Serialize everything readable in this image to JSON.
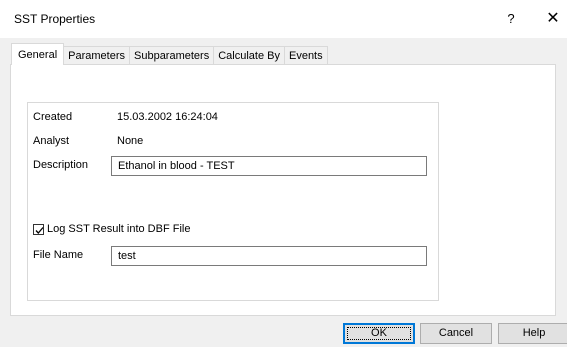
{
  "window": {
    "title": "SST Properties",
    "help_glyph": "?",
    "close_glyph": "✕"
  },
  "tabs": [
    {
      "label": "General",
      "active": true
    },
    {
      "label": "Parameters",
      "active": false
    },
    {
      "label": "Subparameters",
      "active": false
    },
    {
      "label": "Calculate By",
      "active": false
    },
    {
      "label": "Events",
      "active": false
    }
  ],
  "general": {
    "created_label": "Created",
    "created_value": "15.03.2002 16:24:04",
    "analyst_label": "Analyst",
    "analyst_value": "None",
    "description_label": "Description",
    "description_value": "Ethanol in blood - TEST",
    "log_checkbox_label": "Log SST Result into DBF File",
    "log_checked": true,
    "filename_label": "File Name",
    "filename_value": "test"
  },
  "buttons": {
    "ok": "OK",
    "cancel": "Cancel",
    "help": "Help"
  }
}
